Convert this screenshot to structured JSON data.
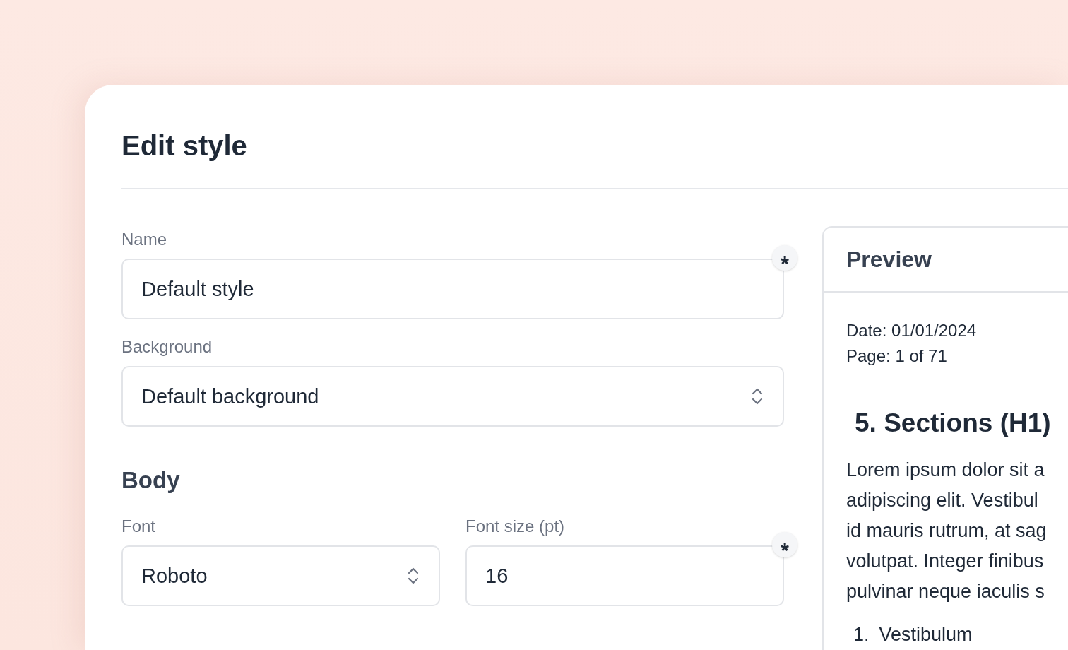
{
  "dialog": {
    "title": "Edit style"
  },
  "fields": [
    {
      "label": "Name",
      "kind": "text",
      "value": "Default style",
      "required_mark": "*"
    },
    {
      "label": "Background",
      "kind": "select",
      "value": "Default background"
    }
  ],
  "body": {
    "heading": "Body",
    "fields": [
      {
        "label": "Font",
        "kind": "select",
        "value": "Roboto"
      },
      {
        "label": "Font size (pt)",
        "kind": "text",
        "value": "16",
        "required_mark": "*"
      }
    ]
  },
  "preview": {
    "title": "Preview",
    "meta": [
      "Date: 01/01/2024",
      "Page: 1 of 71"
    ],
    "heading": "5. Sections (H1)",
    "paragraph_lines": [
      "Lorem ipsum dolor sit a",
      "adipiscing elit. Vestibul",
      "id mauris rutrum, at sag",
      "volutpat. Integer finibus",
      "pulvinar neque iaculis s"
    ],
    "list": [
      {
        "number": "1.",
        "text": "Vestibulum"
      }
    ]
  }
}
